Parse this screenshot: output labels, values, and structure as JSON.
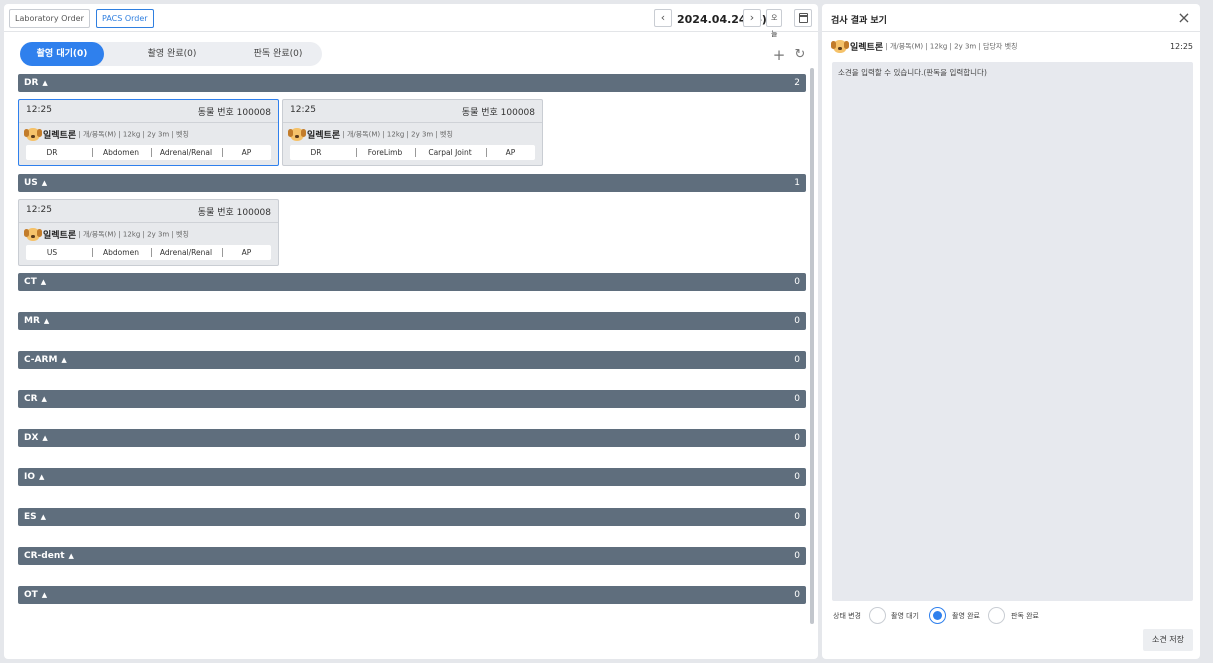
{
  "topbar": {
    "order_tabs": [
      {
        "label": "Laboratory Order",
        "active": false
      },
      {
        "label": "PACS Order",
        "active": true
      }
    ],
    "date": "2024.04.24(수)",
    "today_label": "오늘",
    "prev_icon": "chevron-left-icon",
    "next_icon": "chevron-right-icon",
    "calendar_icon": "calendar-icon"
  },
  "status_tabs": [
    {
      "label": "촬영 대기(0)",
      "active": true
    },
    {
      "label": "촬영 완료(0)",
      "active": false
    },
    {
      "label": "판독 완료(0)",
      "active": false
    }
  ],
  "toolbar_icons": [
    "plus-icon",
    "refresh-icon"
  ],
  "groups": [
    {
      "name": "DR",
      "count": "2",
      "cards": [
        {
          "time": "12:25",
          "animal_no": "동물 번호 100008",
          "patient": "일렉트론",
          "meta": "개/봉독(M) | 12kg | 2y 3m | 벳칭",
          "exam": [
            "DR",
            "Abdomen",
            "Adrenal/Renal",
            "AP"
          ],
          "selected": true
        },
        {
          "time": "12:25",
          "animal_no": "동물 번호 100008",
          "patient": "일렉트론",
          "meta": "개/봉독(M) | 12kg | 2y 3m | 벳칭",
          "exam": [
            "DR",
            "ForeLimb",
            "Carpal Joint",
            "AP"
          ],
          "selected": false
        }
      ]
    },
    {
      "name": "US",
      "count": "1",
      "cards": [
        {
          "time": "12:25",
          "animal_no": "동물 번호 100008",
          "patient": "일렉트론",
          "meta": "개/봉독(M) | 12kg | 2y 3m | 벳칭",
          "exam": [
            "US",
            "Abdomen",
            "Adrenal/Renal",
            "AP"
          ],
          "selected": false
        }
      ]
    },
    {
      "name": "CT",
      "count": "0",
      "cards": []
    },
    {
      "name": "MR",
      "count": "0",
      "cards": []
    },
    {
      "name": "C-ARM",
      "count": "0",
      "cards": []
    },
    {
      "name": "CR",
      "count": "0",
      "cards": []
    },
    {
      "name": "DX",
      "count": "0",
      "cards": []
    },
    {
      "name": "IO",
      "count": "0",
      "cards": []
    },
    {
      "name": "ES",
      "count": "0",
      "cards": []
    },
    {
      "name": "CR-dent",
      "count": "0",
      "cards": []
    },
    {
      "name": "OT",
      "count": "0",
      "cards": []
    }
  ],
  "result_panel": {
    "title": "검사 결과 보기",
    "close_icon": "close-icon",
    "patient_name": "일렉트론",
    "patient_meta": "개/봉독(M) | 12kg | 2y 3m | 담당자 벳칭",
    "time": "12:25",
    "placeholder": "소견을 입력할 수 있습니다.(판독을 입력합니다)",
    "status_label": "상태 변경",
    "status_options": [
      {
        "label": "촬영 대기",
        "checked": false
      },
      {
        "label": "촬영 완료",
        "checked": true
      },
      {
        "label": "판독 완료",
        "checked": false
      }
    ],
    "save_label": "소견 저장"
  }
}
